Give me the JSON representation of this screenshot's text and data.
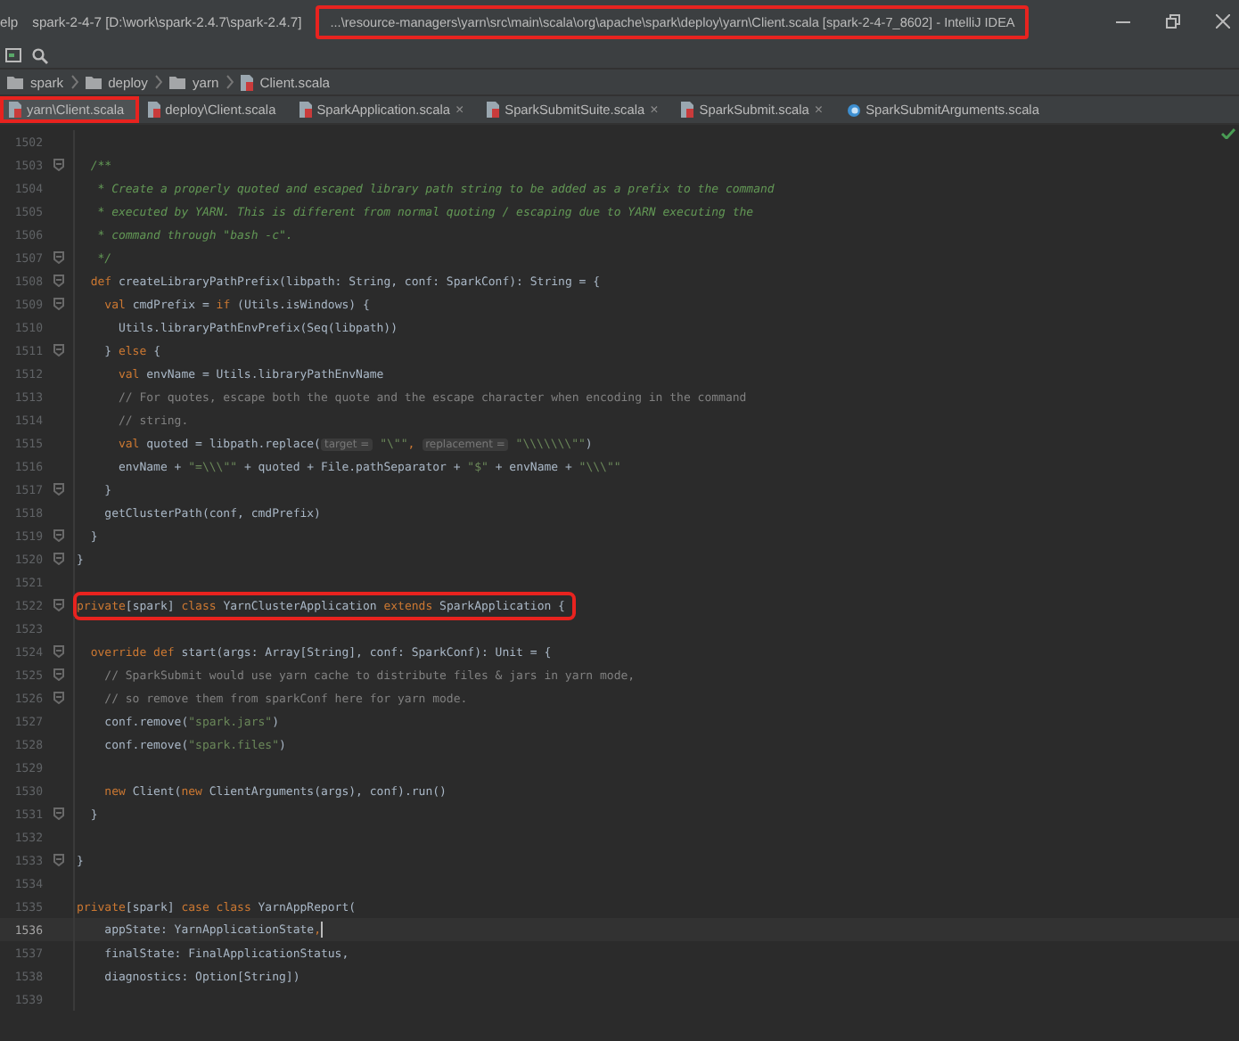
{
  "menu_fragment": "elp",
  "project": "spark-2-4-7 [D:\\work\\spark-2.4.7\\spark-2.4.7]",
  "window": {
    "title": "...\\resource-managers\\yarn\\src\\main\\scala\\org\\apache\\spark\\deploy\\yarn\\Client.scala [spark-2-4-7_8602] - IntelliJ IDEA",
    "highlighted": true
  },
  "breadcrumbs": [
    {
      "label": "spark",
      "kind": "folder"
    },
    {
      "label": "deploy",
      "kind": "folder"
    },
    {
      "label": "yarn",
      "kind": "folder"
    },
    {
      "label": "Client.scala",
      "kind": "file"
    }
  ],
  "tabs": [
    {
      "label": "yarn\\Client.scala",
      "selected": true,
      "highlighted": true,
      "kind": "scala"
    },
    {
      "label": "deploy\\Client.scala",
      "selected": false,
      "highlighted": false,
      "kind": "scala"
    },
    {
      "label": "SparkApplication.scala",
      "selected": false,
      "highlighted": false,
      "close": "×",
      "kind": "scala"
    },
    {
      "label": "SparkSubmitSuite.scala",
      "selected": false,
      "highlighted": false,
      "close": "×",
      "kind": "scala"
    },
    {
      "label": "SparkSubmit.scala",
      "selected": false,
      "highlighted": false,
      "close": "×",
      "kind": "scala"
    },
    {
      "label": "SparkSubmitArguments.scala",
      "selected": false,
      "highlighted": false,
      "kind": "object"
    }
  ],
  "lines": [
    {
      "number": "1502",
      "fold": false
    },
    {
      "number": "1503",
      "fold": true,
      "segments": [
        {
          "kind": "doc",
          "text": "  /**"
        }
      ]
    },
    {
      "number": "1504",
      "fold": false,
      "segments": [
        {
          "kind": "doc",
          "text": "   * Create a properly quoted and escaped library path string to be added as a prefix to the command"
        }
      ]
    },
    {
      "number": "1505",
      "fold": false,
      "segments": [
        {
          "kind": "doc",
          "text": "   * executed by YARN. This is different from normal quoting / escaping due to YARN executing the"
        }
      ]
    },
    {
      "number": "1506",
      "fold": false,
      "segments": [
        {
          "kind": "doc",
          "text": "   * command through \"bash -c\"."
        }
      ]
    },
    {
      "number": "1507",
      "fold": true,
      "segments": [
        {
          "kind": "doc",
          "text": "   */"
        }
      ]
    },
    {
      "number": "1508",
      "fold": true,
      "segments": [
        {
          "kind": "keyword",
          "text": "  def "
        },
        {
          "kind": "plain",
          "text": "createLibraryPathPrefix(libpath: String, conf: SparkConf): String = {"
        }
      ]
    },
    {
      "number": "1509",
      "fold": true,
      "segments": [
        {
          "kind": "keyword",
          "text": "    val "
        },
        {
          "kind": "plain",
          "text": "cmdPrefix = "
        },
        {
          "kind": "keyword",
          "text": "if "
        },
        {
          "kind": "plain",
          "text": "(Utils.isWindows) {"
        }
      ]
    },
    {
      "number": "1510",
      "fold": false,
      "segments": [
        {
          "kind": "plain",
          "text": "      Utils.libraryPathEnvPrefix(Seq(libpath))"
        }
      ]
    },
    {
      "number": "1511",
      "fold": true,
      "segments": [
        {
          "kind": "plain",
          "text": "    } "
        },
        {
          "kind": "keyword",
          "text": "else "
        },
        {
          "kind": "plain",
          "text": "{"
        }
      ]
    },
    {
      "number": "1512",
      "fold": false,
      "segments": [
        {
          "kind": "keyword",
          "text": "      val "
        },
        {
          "kind": "plain",
          "text": "envName = Utils.libraryPathEnvName"
        }
      ]
    },
    {
      "number": "1513",
      "fold": false,
      "segments": [
        {
          "kind": "comment",
          "text": "      // For quotes, escape both the quote and the escape character when encoding in the command"
        }
      ]
    },
    {
      "number": "1514",
      "fold": false,
      "segments": [
        {
          "kind": "comment",
          "text": "      // string."
        }
      ]
    },
    {
      "number": "1515",
      "fold": false,
      "segments": [
        {
          "kind": "keyword",
          "text": "      val "
        },
        {
          "kind": "plain",
          "text": "quoted = libpath.replace("
        },
        {
          "kind": "hint",
          "text": "target ="
        },
        {
          "kind": "string",
          "text": " \"\\\"\""
        },
        {
          "kind": "keyword",
          "text": ", "
        },
        {
          "kind": "hint",
          "text": "replacement ="
        },
        {
          "kind": "string",
          "text": " \"\\\\\\\\\\\\\\\"\""
        },
        {
          "kind": "plain",
          "text": ")"
        }
      ]
    },
    {
      "number": "1516",
      "fold": false,
      "segments": [
        {
          "kind": "plain",
          "text": "      envName + "
        },
        {
          "kind": "string",
          "text": "\"=\\\\\\\"\""
        },
        {
          "kind": "plain",
          "text": " + quoted + File.pathSeparator + "
        },
        {
          "kind": "string",
          "text": "\"$\""
        },
        {
          "kind": "plain",
          "text": " + envName + "
        },
        {
          "kind": "string",
          "text": "\"\\\\\\\"\""
        }
      ]
    },
    {
      "number": "1517",
      "fold": true,
      "segments": [
        {
          "kind": "plain",
          "text": "    }"
        }
      ]
    },
    {
      "number": "1518",
      "fold": false,
      "segments": [
        {
          "kind": "plain",
          "text": "    getClusterPath(conf, cmdPrefix)"
        }
      ]
    },
    {
      "number": "1519",
      "fold": true,
      "segments": [
        {
          "kind": "plain",
          "text": "  }"
        }
      ]
    },
    {
      "number": "1520",
      "fold": true,
      "segments": [
        {
          "kind": "plain",
          "text": "}"
        }
      ]
    },
    {
      "number": "1521",
      "fold": false
    },
    {
      "number": "1522",
      "fold": true,
      "highlighted": true,
      "segments": [
        {
          "kind": "keyword",
          "text": "private"
        },
        {
          "kind": "plain",
          "text": "[spark] "
        },
        {
          "kind": "keyword",
          "text": "class "
        },
        {
          "kind": "plain",
          "text": "YarnClusterApplication "
        },
        {
          "kind": "keyword",
          "text": "extends "
        },
        {
          "kind": "plain",
          "text": "SparkApplication {"
        }
      ]
    },
    {
      "number": "1523",
      "fold": false
    },
    {
      "number": "1524",
      "fold": true,
      "segments": [
        {
          "kind": "keyword",
          "text": "  override def "
        },
        {
          "kind": "plain",
          "text": "start(args: Array[String], conf: SparkConf): Unit = {"
        }
      ]
    },
    {
      "number": "1525",
      "fold": true,
      "segments": [
        {
          "kind": "comment",
          "text": "    // SparkSubmit would use yarn cache to distribute files & jars in yarn mode,"
        }
      ]
    },
    {
      "number": "1526",
      "fold": true,
      "segments": [
        {
          "kind": "comment",
          "text": "    // so remove them from sparkConf here for yarn mode."
        }
      ]
    },
    {
      "number": "1527",
      "fold": false,
      "segments": [
        {
          "kind": "plain",
          "text": "    conf.remove("
        },
        {
          "kind": "string",
          "text": "\"spark.jars\""
        },
        {
          "kind": "plain",
          "text": ")"
        }
      ]
    },
    {
      "number": "1528",
      "fold": false,
      "segments": [
        {
          "kind": "plain",
          "text": "    conf.remove("
        },
        {
          "kind": "string",
          "text": "\"spark.files\""
        },
        {
          "kind": "plain",
          "text": ")"
        }
      ]
    },
    {
      "number": "1529",
      "fold": false
    },
    {
      "number": "1530",
      "fold": false,
      "segments": [
        {
          "kind": "keyword",
          "text": "    new "
        },
        {
          "kind": "plain",
          "text": "Client("
        },
        {
          "kind": "keyword",
          "text": "new "
        },
        {
          "kind": "plain",
          "text": "ClientArguments(args), conf).run()"
        }
      ]
    },
    {
      "number": "1531",
      "fold": true,
      "segments": [
        {
          "kind": "plain",
          "text": "  }"
        }
      ]
    },
    {
      "number": "1532",
      "fold": false
    },
    {
      "number": "1533",
      "fold": true,
      "segments": [
        {
          "kind": "plain",
          "text": "}"
        }
      ]
    },
    {
      "number": "1534",
      "fold": false
    },
    {
      "number": "1535",
      "fold": false,
      "segments": [
        {
          "kind": "keyword",
          "text": "private"
        },
        {
          "kind": "plain",
          "text": "[spark] "
        },
        {
          "kind": "keyword",
          "text": "case class "
        },
        {
          "kind": "plain",
          "text": "YarnAppReport("
        }
      ]
    },
    {
      "number": "1536",
      "fold": false,
      "current": true,
      "segments": [
        {
          "kind": "plain",
          "text": "    appState: YarnApplicationState"
        },
        {
          "kind": "keyword",
          "text": ","
        }
      ]
    },
    {
      "number": "1537",
      "fold": false,
      "segments": [
        {
          "kind": "plain",
          "text": "    finalState: FinalApplicationStatus,"
        }
      ]
    },
    {
      "number": "1538",
      "fold": false,
      "segments": [
        {
          "kind": "plain",
          "text": "    diagnostics: Option[String])"
        }
      ]
    },
    {
      "number": "1539",
      "fold": false
    }
  ]
}
